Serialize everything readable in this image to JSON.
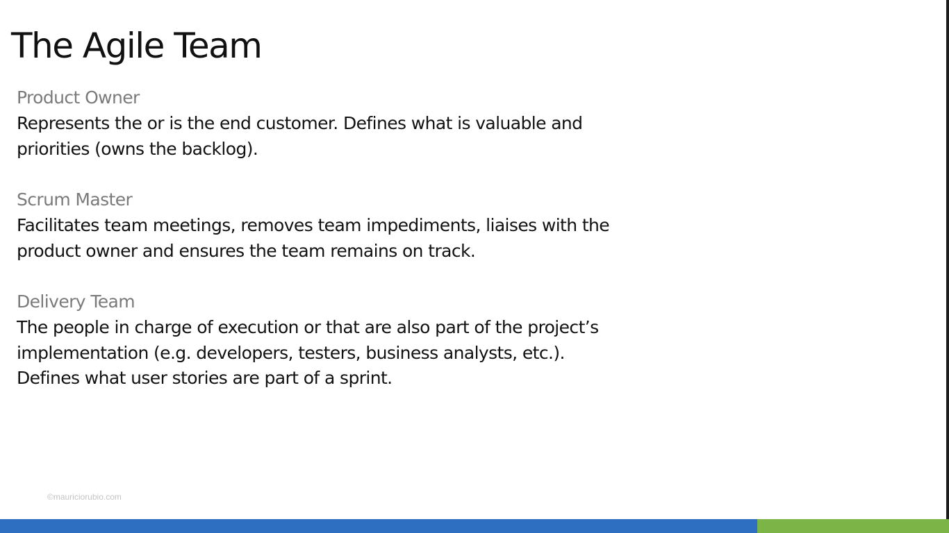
{
  "slide": {
    "title": "The Agile Team",
    "sections": [
      {
        "heading": "Product Owner",
        "lines": [
          "Represents the or is the end customer. Defines what is valuable and",
          "priorities (owns the backlog)."
        ]
      },
      {
        "heading": "Scrum Master",
        "lines": [
          "Facilitates team meetings, removes team impediments, liaises with the",
          "product owner and ensures the team remains on track."
        ]
      },
      {
        "heading": "Delivery Team",
        "lines": [
          "The people in charge of execution or that are also part of the project’s",
          "implementation (e.g. developers, testers, business analysts, etc.).",
          "Defines what user stories are part of a sprint."
        ]
      }
    ],
    "watermark": "©mauriciorubio.com"
  },
  "colors": {
    "heading": "#7a7a7a",
    "body": "#111111",
    "bar_blue": "#2f6fc2",
    "bar_green": "#7db448"
  }
}
